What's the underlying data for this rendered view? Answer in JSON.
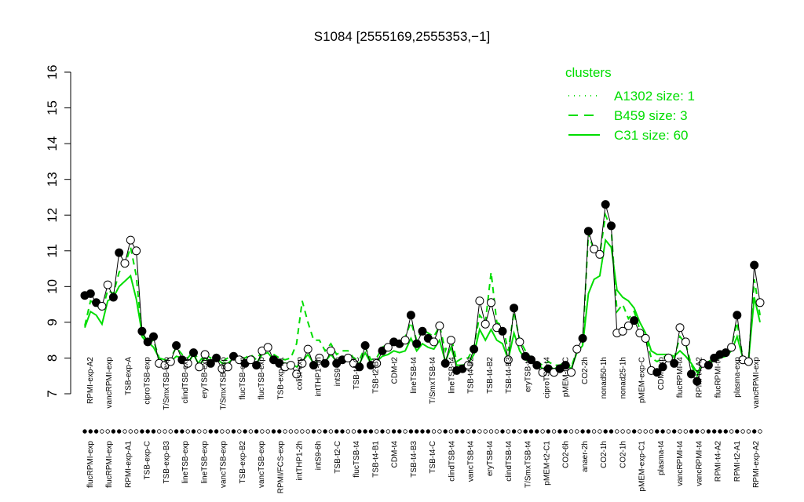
{
  "chart_data": {
    "type": "line",
    "title": "S1084 [2555169,2555353,−1]",
    "xlabel": "",
    "ylabel": "",
    "ylim": [
      7,
      16
    ],
    "y_ticks": [
      7,
      8,
      9,
      10,
      11,
      12,
      13,
      14,
      15,
      16
    ],
    "legend": {
      "title": "clusters",
      "position": "top-right",
      "color": "#00dd00",
      "entries": [
        {
          "label": "A1302 size: 1",
          "style": "dotted"
        },
        {
          "label": "B459 size: 3",
          "style": "dashed"
        },
        {
          "label": "C31 size: 60",
          "style": "solid"
        }
      ]
    },
    "x_labels_upper": [
      "RPMI-exp-A2",
      "vancRPMI-exp",
      "TSB-exp-A",
      "ciproTSB-exp",
      "T/SmxTSB-exp",
      "clindTSB-exp",
      "eryTSB-exp",
      "T/SmxTSB-exp",
      "flucTSB-exp",
      "flucTSB-exp",
      "TSB-exp-B1",
      "colist-exp",
      "intTHP1-6h",
      "intS9-2h",
      "TSB-t4-C",
      "TSB-t2-B1",
      "CDM-t2",
      "lineTSB-t4",
      "T/SmxTSB-t4",
      "lineTSB-t4",
      "TSB-t4-B2",
      "TSB-t4-B2",
      "TSB-t4-B3",
      "eryTSB-t4",
      "ciproTSB-t4",
      "pMEM-t4-C",
      "CO2-2h",
      "nonad50-1h",
      "nonad25-1h",
      "pMEM-exp-C",
      "CDM-exp",
      "flucRPMI-t4",
      "RPMI-t4-A2",
      "flucRPMI-t4",
      "plasma-exp",
      "vancRPMI-exp"
    ],
    "x_labels_lower": [
      "flucRPMI-exp",
      "flucRPMI-exp",
      "RPMI-exp-A1",
      "TSB-exp-C",
      "TSB-exp-B3",
      "lineTSB-exp",
      "lineTSB-exp",
      "vancTSB-exp",
      "TSB-exp-B2",
      "vancTSB-exp",
      "RPMI/FCS-exp",
      "intTHP1-2h",
      "intS9-6h",
      "TSB-t2-C",
      "flucTSB-t4",
      "TSB-t4-B1",
      "CDM-t4",
      "TSB-t4-B3",
      "TSB-t4-C",
      "clindTSB-t4",
      "vancTSB-t4",
      "eryTSB-t4",
      "clindTSB-t4",
      "T/SmxTSB-t4",
      "pMEM-t2-C1",
      "CO2-6h",
      "anaer-2h",
      "CO2-1h",
      "CO2-1h",
      "pMEM-exp-C1",
      "plasma-t4",
      "vancRPMI-t4",
      "vancRPMI-t4",
      "RPMI-t4-A2",
      "RPMI-t2-A1",
      "RPMI-exp-A2"
    ],
    "series": [
      {
        "values": [
          9.75,
          9.8,
          9.55,
          9.45,
          10.05,
          9.7,
          10.95,
          10.65,
          11.3,
          11.0,
          8.75,
          8.45,
          8.6,
          7.85,
          7.8,
          7.9,
          8.35,
          7.95,
          7.85,
          8.15,
          7.75,
          8.1,
          7.85,
          8.0,
          7.7,
          7.75,
          8.05,
          7.95,
          7.85,
          7.95,
          7.8,
          8.2,
          8.3,
          7.95,
          7.85,
          7.75,
          7.8,
          7.55,
          7.85,
          8.25,
          7.8,
          8.0,
          7.85,
          8.2,
          7.85,
          7.95,
          8.0,
          7.85,
          7.75,
          8.35,
          7.8,
          7.85,
          8.2,
          8.3,
          8.45,
          8.4,
          8.5,
          9.2,
          8.4,
          8.75,
          8.55,
          8.45,
          8.9,
          7.85,
          8.5,
          7.65,
          7.7,
          7.8,
          8.25,
          9.6,
          8.95,
          9.55,
          8.85,
          8.75,
          7.95,
          9.4,
          8.45,
          8.05,
          7.95,
          7.8,
          7.6,
          7.7,
          7.6,
          7.7,
          7.8,
          7.6,
          8.25,
          8.55,
          11.55,
          11.05,
          10.9,
          12.3,
          11.7,
          8.7,
          8.75,
          8.9,
          9.05,
          8.7,
          8.55,
          7.65,
          7.6,
          7.75,
          8.0,
          7.85,
          8.85,
          8.45,
          7.55,
          7.35,
          7.85,
          7.8,
          8.0,
          8.1,
          8.15,
          8.3,
          9.2,
          7.95,
          7.9,
          10.6,
          9.55
        ],
        "filled": [
          1,
          1,
          1,
          0,
          0,
          1,
          1,
          0,
          0,
          0,
          1,
          1,
          1,
          0,
          0,
          0,
          1,
          1,
          0,
          1,
          0,
          0,
          1,
          1,
          0,
          0,
          1,
          0,
          1,
          0,
          1,
          0,
          0,
          1,
          1,
          0,
          0,
          0,
          0,
          0,
          1,
          0,
          1,
          0,
          1,
          1,
          0,
          0,
          1,
          1,
          1,
          0,
          1,
          0,
          1,
          1,
          0,
          1,
          1,
          1,
          1,
          0,
          0,
          1,
          0,
          1,
          1,
          0,
          1,
          0,
          0,
          0,
          0,
          1,
          0,
          1,
          0,
          1,
          1,
          1,
          0,
          1,
          0,
          1,
          1,
          0,
          0,
          1,
          1,
          0,
          0,
          1,
          1,
          0,
          0,
          0,
          1,
          0,
          0,
          0,
          1,
          1,
          0,
          1,
          0,
          0,
          1,
          1,
          0,
          1,
          1,
          1,
          1,
          0,
          1,
          0,
          0,
          1,
          0
        ]
      }
    ],
    "cluster_means": {
      "C31": [
        8.85,
        9.3,
        9.2,
        8.95,
        9.6,
        9.7,
        10.0,
        10.15,
        10.3,
        9.65,
        8.7,
        8.45,
        8.3,
        8.0,
        7.95,
        7.9,
        8.05,
        8.0,
        7.85,
        8.1,
        7.8,
        8.0,
        7.9,
        8.0,
        7.85,
        7.85,
        8.0,
        7.9,
        7.9,
        7.95,
        7.85,
        8.1,
        8.15,
        7.95,
        7.9,
        7.85,
        7.85,
        7.75,
        7.9,
        8.1,
        7.85,
        7.95,
        7.9,
        8.1,
        7.9,
        7.95,
        7.95,
        7.9,
        7.85,
        8.15,
        7.85,
        7.9,
        8.05,
        8.1,
        8.2,
        8.15,
        8.2,
        8.55,
        8.2,
        8.4,
        8.3,
        8.25,
        8.5,
        7.9,
        8.3,
        7.8,
        7.8,
        7.85,
        8.1,
        8.8,
        8.5,
        8.8,
        8.5,
        8.4,
        7.95,
        8.7,
        8.2,
        7.95,
        7.9,
        7.85,
        7.7,
        7.75,
        7.7,
        7.75,
        7.85,
        7.7,
        8.15,
        8.35,
        9.8,
        10.2,
        10.3,
        11.3,
        11.1,
        9.9,
        9.7,
        9.6,
        9.4,
        9.0,
        8.7,
        8.2,
        8.1,
        8.1,
        8.1,
        8.05,
        8.2,
        8.05,
        7.85,
        7.6,
        7.8,
        7.8,
        7.95,
        8.0,
        8.05,
        8.2,
        8.6,
        8.0,
        7.95,
        9.7,
        9.0
      ],
      "B459": [
        8.9,
        9.6,
        9.5,
        9.3,
        9.9,
        9.8,
        10.4,
        10.6,
        11.1,
        10.3,
        8.6,
        8.4,
        8.5,
        8.0,
        7.9,
        8.0,
        8.3,
        8.1,
        8.0,
        8.2,
        7.9,
        8.1,
        8.0,
        8.1,
        7.9,
        8.0,
        8.1,
        8.0,
        8.0,
        8.1,
        7.95,
        8.2,
        8.3,
        8.1,
        8.0,
        7.95,
        8.0,
        8.4,
        9.6,
        9.0,
        8.5,
        8.5,
        8.2,
        8.4,
        8.1,
        8.2,
        8.2,
        8.0,
        7.95,
        8.3,
        7.95,
        8.0,
        8.3,
        8.4,
        8.5,
        8.5,
        8.6,
        9.0,
        8.5,
        8.8,
        8.7,
        8.6,
        8.9,
        8.2,
        8.6,
        7.9,
        8.0,
        8.0,
        8.3,
        9.2,
        9.0,
        10.4,
        9.0,
        8.9,
        8.2,
        9.3,
        8.5,
        8.2,
        8.0,
        7.9,
        7.8,
        7.9,
        7.8,
        7.8,
        7.9,
        7.75,
        8.2,
        8.4,
        11.5,
        11.0,
        10.9,
        12.0,
        11.6,
        9.3,
        9.5,
        9.1,
        9.3,
        8.8,
        8.6,
        8.0,
        7.9,
        8.0,
        8.1,
        8.0,
        8.6,
        8.4,
        7.8,
        7.5,
        7.9,
        7.9,
        8.0,
        8.1,
        8.2,
        8.3,
        9.0,
        8.0,
        7.9,
        10.2,
        9.2
      ]
    },
    "grid": false
  }
}
